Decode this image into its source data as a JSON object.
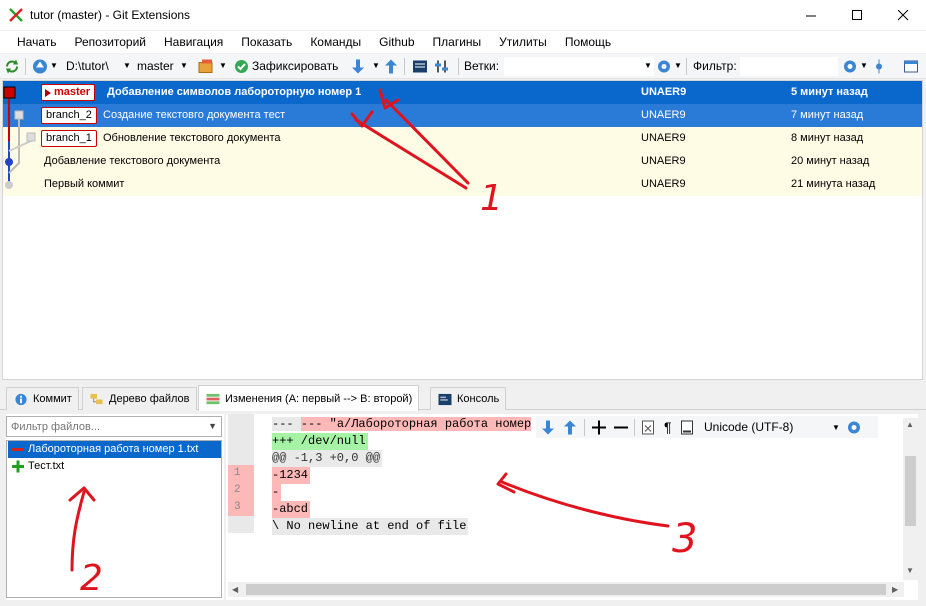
{
  "window": {
    "title": "tutor (master) - Git Extensions",
    "minimize": "—",
    "maximize": "☐",
    "close": "✕"
  },
  "menu": [
    "Начать",
    "Репозиторий",
    "Навигация",
    "Показать",
    "Команды",
    "Github",
    "Плагины",
    "Утилиты",
    "Помощь"
  ],
  "toolbar": {
    "repo_path": "D:\\tutor\\",
    "branch": "master",
    "commit_label": "Зафиксировать",
    "branches_label": "Ветки:",
    "filter_label": "Фильтр:"
  },
  "commits": [
    {
      "branch": "master",
      "message": "Добавление символов лабороторную номер 1",
      "author": "UNAER9",
      "date": "5 минут назад"
    },
    {
      "branch": "branch_2",
      "message": "Создание текстовго документа тест",
      "author": "UNAER9",
      "date": "7 минут назад"
    },
    {
      "branch": "branch_1",
      "message": "Обновление текстового документа",
      "author": "UNAER9",
      "date": "8 минут назад"
    },
    {
      "branch": "",
      "message": "Добавление текстового документа",
      "author": "UNAER9",
      "date": "20 минут назад"
    },
    {
      "branch": "",
      "message": "Первый коммит",
      "author": "UNAER9",
      "date": "21 минута назад"
    }
  ],
  "tabs": [
    "Коммит",
    "Дерево файлов",
    "Изменения (A: первый --> B: второй)",
    "Консоль"
  ],
  "file_filter": {
    "placeholder": "Фильтр файлов..."
  },
  "files": [
    {
      "name": "Лабороторная работа номер 1.txt",
      "status": "deleted"
    },
    {
      "name": "Тест.txt",
      "status": "added"
    }
  ],
  "diff": {
    "lines": [
      {
        "text": "--- \"a/Лабороторная работа номер",
        "kind": "del-header"
      },
      {
        "text": "+++ /dev/null",
        "kind": "add-header"
      },
      {
        "text": "@@ -1,3 +0,0 @@",
        "kind": "hunk"
      },
      {
        "text": "-1234",
        "kind": "del",
        "num": "1"
      },
      {
        "text": "-",
        "kind": "del",
        "num": "2"
      },
      {
        "text": "-abcd",
        "kind": "del",
        "num": "3"
      },
      {
        "text": "\\ No newline at end of file",
        "kind": "ctx"
      }
    ],
    "encoding": "Unicode (UTF-8)"
  },
  "annotations": [
    "1",
    "2",
    "3"
  ],
  "colors": {
    "selection": "#0a67cc",
    "branch_border": "#cc0000",
    "deleted": "#fdb8b8",
    "added": "#a6f3a6",
    "annotation": "#e0141e"
  }
}
